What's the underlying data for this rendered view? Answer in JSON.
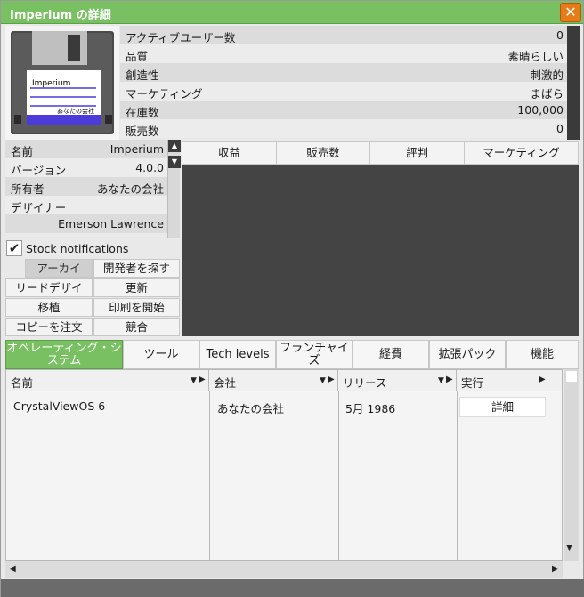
{
  "window": {
    "title": "Imperium の詳細",
    "close": "✕"
  },
  "floppy": {
    "label_name": "Imperium",
    "label_owner": "あなたの会社"
  },
  "stats": [
    {
      "label": "アクティブユーザー数",
      "value": "0"
    },
    {
      "label": "品質",
      "value": "素晴らしい"
    },
    {
      "label": "創造性",
      "value": "刺激的"
    },
    {
      "label": "マーケティング",
      "value": "まばら"
    },
    {
      "label": "在庫数",
      "value": "100,000"
    },
    {
      "label": "販売数",
      "value": "0"
    }
  ],
  "info": [
    {
      "label": "名前",
      "value": "Imperium"
    },
    {
      "label": "バージョン",
      "value": "4.0.0"
    },
    {
      "label": "所有者",
      "value": "あなたの会社"
    },
    {
      "label": "デザイナー",
      "value": ""
    },
    {
      "label": "",
      "value": "Emerson Lawrence"
    }
  ],
  "stock_notifications": {
    "label": "Stock notifications",
    "checked": true,
    "mark": "✔"
  },
  "actions": {
    "archive": "アーカイ",
    "find_developer": "開発者を探す",
    "lead_design": "リードデザイ",
    "update": "更新",
    "port": "移植",
    "start_print": "印刷を開始",
    "order_copies": "コピーを注文",
    "compete": "競合"
  },
  "chart_tabs": [
    "収益",
    "販売数",
    "評判",
    "マーケティング"
  ],
  "category_tabs": [
    {
      "label": "オペレーティング・システム",
      "active": true
    },
    {
      "label": "ツール",
      "active": false
    },
    {
      "label": "Tech levels",
      "active": false
    },
    {
      "label": "フランチャイズ",
      "active": false
    },
    {
      "label": "経費",
      "active": false
    },
    {
      "label": "拡張パック",
      "active": false
    },
    {
      "label": "機能",
      "active": false
    }
  ],
  "table": {
    "columns": [
      "名前",
      "会社",
      "リリース",
      "実行"
    ],
    "rows": [
      {
        "name": "CrystalViewOS 6",
        "company": "あなたの会社",
        "release": "5月 1986",
        "action": "詳細"
      }
    ]
  },
  "colors": {
    "accent": "#79c062",
    "close": "#e67b19",
    "chart_bg": "#444444"
  }
}
